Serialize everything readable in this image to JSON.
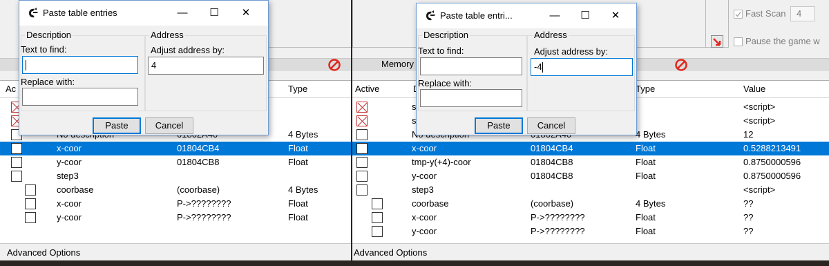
{
  "left": {
    "memory_label": "",
    "headers": {
      "active": "Ac",
      "description": "",
      "address": "",
      "type": "Type"
    },
    "rows": [
      {
        "checkbox": "x",
        "desc": "",
        "address": "",
        "type": "",
        "value": ""
      },
      {
        "checkbox": "x",
        "desc": "",
        "address": "",
        "type": "",
        "value": ""
      },
      {
        "checkbox": "plain",
        "desc": "No description",
        "address": "01802A40",
        "type": "4 Bytes",
        "value": ""
      },
      {
        "checkbox": "plain",
        "desc": "x-coor",
        "address": "01804CB4",
        "type": "Float",
        "value": "",
        "selected": true
      },
      {
        "checkbox": "plain",
        "desc": "y-coor",
        "address": "01804CB8",
        "type": "Float",
        "value": ""
      },
      {
        "checkbox": "plain",
        "desc": "step3",
        "address": "",
        "type": "",
        "value": ""
      },
      {
        "checkbox": "plain",
        "indent": true,
        "desc": "coorbase",
        "address": "(coorbase)",
        "type": "4 Bytes",
        "value": ""
      },
      {
        "checkbox": "plain",
        "indent": true,
        "desc": "x-coor",
        "address": "P->????????",
        "type": "Float",
        "value": ""
      },
      {
        "checkbox": "plain",
        "indent": true,
        "desc": "y-coor",
        "address": "P->????????",
        "type": "Float",
        "value": ""
      }
    ],
    "footer": "Advanced Options",
    "dialog": {
      "title": "Paste table entries",
      "minimize": "—",
      "maximize": "☐",
      "close": "✕",
      "description_group": "Description",
      "address_group": "Address",
      "text_to_find_label": "Text to find:",
      "text_to_find_value": "",
      "replace_with_label": "Replace with:",
      "replace_with_value": "",
      "adjust_label": "Adjust address by:",
      "adjust_value": "4",
      "paste_button": "Paste",
      "cancel_button": "Cancel"
    }
  },
  "right": {
    "memory_label": "Memory",
    "fast_scan_label": "Fast Scan",
    "fast_scan_value": "4",
    "pause_label": "Pause the game w",
    "headers": {
      "active": "Active",
      "description": "D",
      "address": "",
      "type": "Type",
      "value": "Value"
    },
    "rows": [
      {
        "checkbox": "x",
        "desc": "s",
        "address": "",
        "type": "",
        "value": "<script>"
      },
      {
        "checkbox": "x",
        "desc": "s",
        "address": "",
        "type": "",
        "value": "<script>"
      },
      {
        "checkbox": "plain",
        "desc": "No description",
        "address": "01802A40",
        "type": "4 Bytes",
        "value": "12"
      },
      {
        "checkbox": "plain",
        "desc": "x-coor",
        "address": "01804CB4",
        "type": "Float",
        "value": "0.5288213491",
        "selected": true
      },
      {
        "checkbox": "plain",
        "desc": "tmp-y(+4)-coor",
        "address": "01804CB8",
        "type": "Float",
        "value": "0.8750000596"
      },
      {
        "checkbox": "plain",
        "desc": "y-coor",
        "address": "01804CB8",
        "type": "Float",
        "value": "0.8750000596"
      },
      {
        "checkbox": "plain",
        "desc": "step3",
        "address": "",
        "type": "",
        "value": "<script>"
      },
      {
        "checkbox": "plain",
        "indent": true,
        "desc": "coorbase",
        "address": "(coorbase)",
        "type": "4 Bytes",
        "value": "??"
      },
      {
        "checkbox": "plain",
        "indent": true,
        "desc": "x-coor",
        "address": "P->????????",
        "type": "Float",
        "value": "??"
      },
      {
        "checkbox": "plain",
        "indent": true,
        "desc": "y-coor",
        "address": "P->????????",
        "type": "Float",
        "value": "??"
      }
    ],
    "footer": "Advanced Options",
    "dialog": {
      "title": "Paste table entri...",
      "minimize": "—",
      "maximize": "☐",
      "close": "✕",
      "description_group": "Description",
      "address_group": "Address",
      "text_to_find_label": "Text to find:",
      "text_to_find_value": "",
      "replace_with_label": "Replace with:",
      "replace_with_value": "",
      "adjust_label": "Adjust address by:",
      "adjust_value": "-4",
      "paste_button": "Paste",
      "cancel_button": "Cancel"
    }
  },
  "colors": {
    "selection": "#0078d7",
    "dialog_border": "#6f9bd1",
    "delete_icon": "#e0261c",
    "checkbox_x": "#c03030"
  },
  "icons": {
    "app": "cheat-engine-icon",
    "delete": "no-entry-icon",
    "pointer": "red-arrow-icon"
  }
}
